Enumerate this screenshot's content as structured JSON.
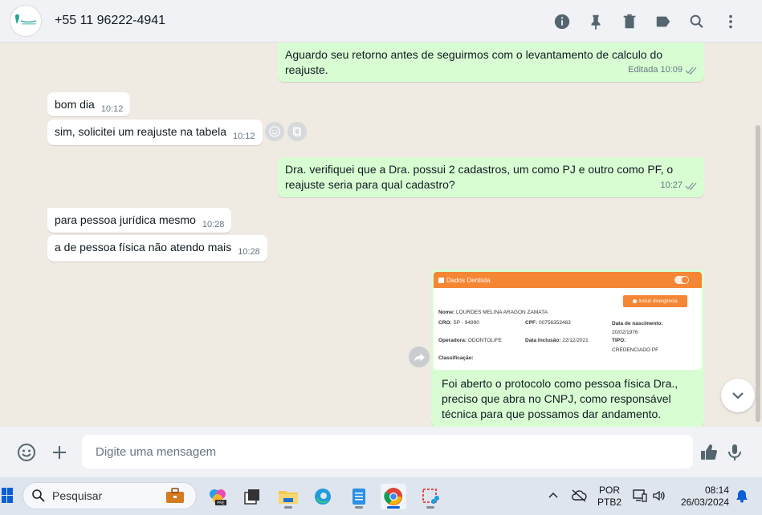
{
  "header": {
    "contact_name": "+55 11 96222-4941",
    "icons": [
      "info-icon",
      "pin-icon",
      "delete-icon",
      "label-icon",
      "search-icon",
      "menu-icon"
    ]
  },
  "messages": [
    {
      "dir": "out",
      "text_lines": [
        "Aguardo seu retorno antes de seguirmos com o levantamento de calculo do",
        "reajuste."
      ],
      "edited": "Editada",
      "time": "10:09"
    },
    {
      "dir": "in",
      "text": "bom dia",
      "time": "10:12"
    },
    {
      "dir": "in",
      "text": "sim, solicitei um reajuste na tabela",
      "time": "10:12"
    },
    {
      "dir": "out",
      "text_lines": [
        "Dra. verifiquei que a Dra. possui 2 cadastros, um como PJ e outro como PF, o",
        "reajuste seria para qual cadastro?"
      ],
      "time": "10:27"
    },
    {
      "dir": "in",
      "text": "para pessoa jurídica mesmo",
      "time": "10:28"
    },
    {
      "dir": "in",
      "text": "a de pessoa física não atendo mais",
      "time": "10:28"
    }
  ],
  "image_card": {
    "header": "Dados Dentista",
    "button": "Incluir divergência",
    "name_label": "Nome:",
    "name_value": "LOURDES MELINA ARAGON ZAMATA",
    "cro_label": "CRO:",
    "cro_value": "SP - 94990",
    "cpf_label": "CPF:",
    "cpf_value": "00756353483",
    "dob_label": "Data de nascimento:",
    "dob_value": "20/02/1976",
    "operadora_label": "Operadora:",
    "operadora_value": "ODONTOLIFE",
    "inclusao_label": "Data Inclusão:",
    "inclusao_value": "22/12/2021",
    "tipo_label": "TIPO:",
    "tipo_value": "CREDENCIADO PF",
    "classificacao_label": "Classificação:"
  },
  "caption_lines": [
    "Foi aberto o protocolo como pessoa física Dra.,",
    "preciso que abra no CNPJ, como responsável",
    "técnica para que possamos dar andamento."
  ],
  "composer": {
    "placeholder": "Digite uma mensagem"
  },
  "taskbar": {
    "search_placeholder": "Pesquisar",
    "lang_top": "POR",
    "lang_bottom": "PTB2",
    "time": "08:14",
    "date": "26/03/2024"
  },
  "colors": {
    "outgoing_bubble": "#d9fdd3",
    "incoming_bubble": "#ffffff",
    "chat_bg": "#efeae2",
    "read_tick": "#53bdeb",
    "card_orange": "#f58634"
  }
}
